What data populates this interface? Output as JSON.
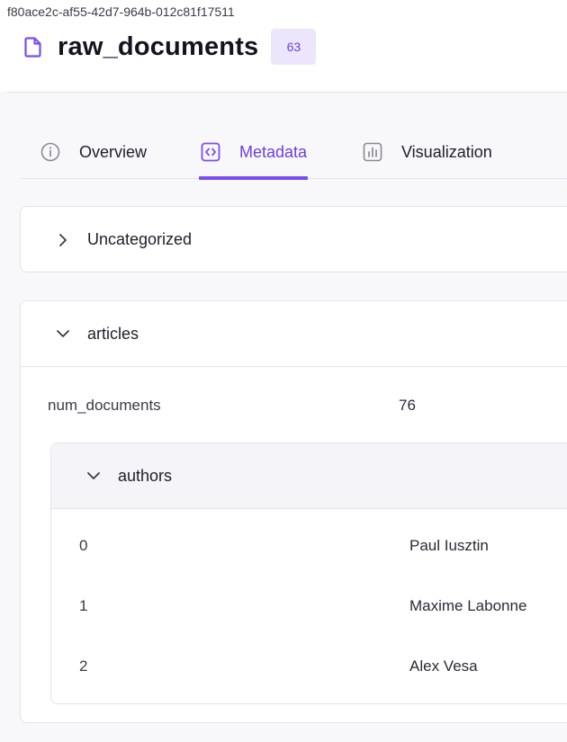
{
  "artifact": {
    "id": "f80ace2c-af55-42d7-964b-012c81f17511",
    "name": "raw_documents",
    "version": "63",
    "icon": "file-icon"
  },
  "tabs": [
    {
      "label": "Overview",
      "icon": "info-icon",
      "active": false
    },
    {
      "label": "Metadata",
      "icon": "code-icon",
      "active": true
    },
    {
      "label": "Visualization",
      "icon": "bar-chart-icon",
      "active": false
    }
  ],
  "sections": {
    "uncategorized": {
      "label": "Uncategorized",
      "expanded": false
    },
    "articles": {
      "label": "articles",
      "expanded": true,
      "num_documents": {
        "key": "num_documents",
        "value": "76"
      },
      "authors": {
        "label": "authors",
        "expanded": true,
        "items": [
          {
            "index": "0",
            "value": "Paul Iusztin"
          },
          {
            "index": "1",
            "value": "Maxime Labonne"
          },
          {
            "index": "2",
            "value": "Alex Vesa"
          }
        ]
      }
    }
  },
  "colors": {
    "accent": "#7c4deb",
    "accent_text": "#6d3fe0",
    "badge_bg": "#ece6fd",
    "border": "#e3e3ea",
    "page_bg": "#f8f8fb"
  }
}
